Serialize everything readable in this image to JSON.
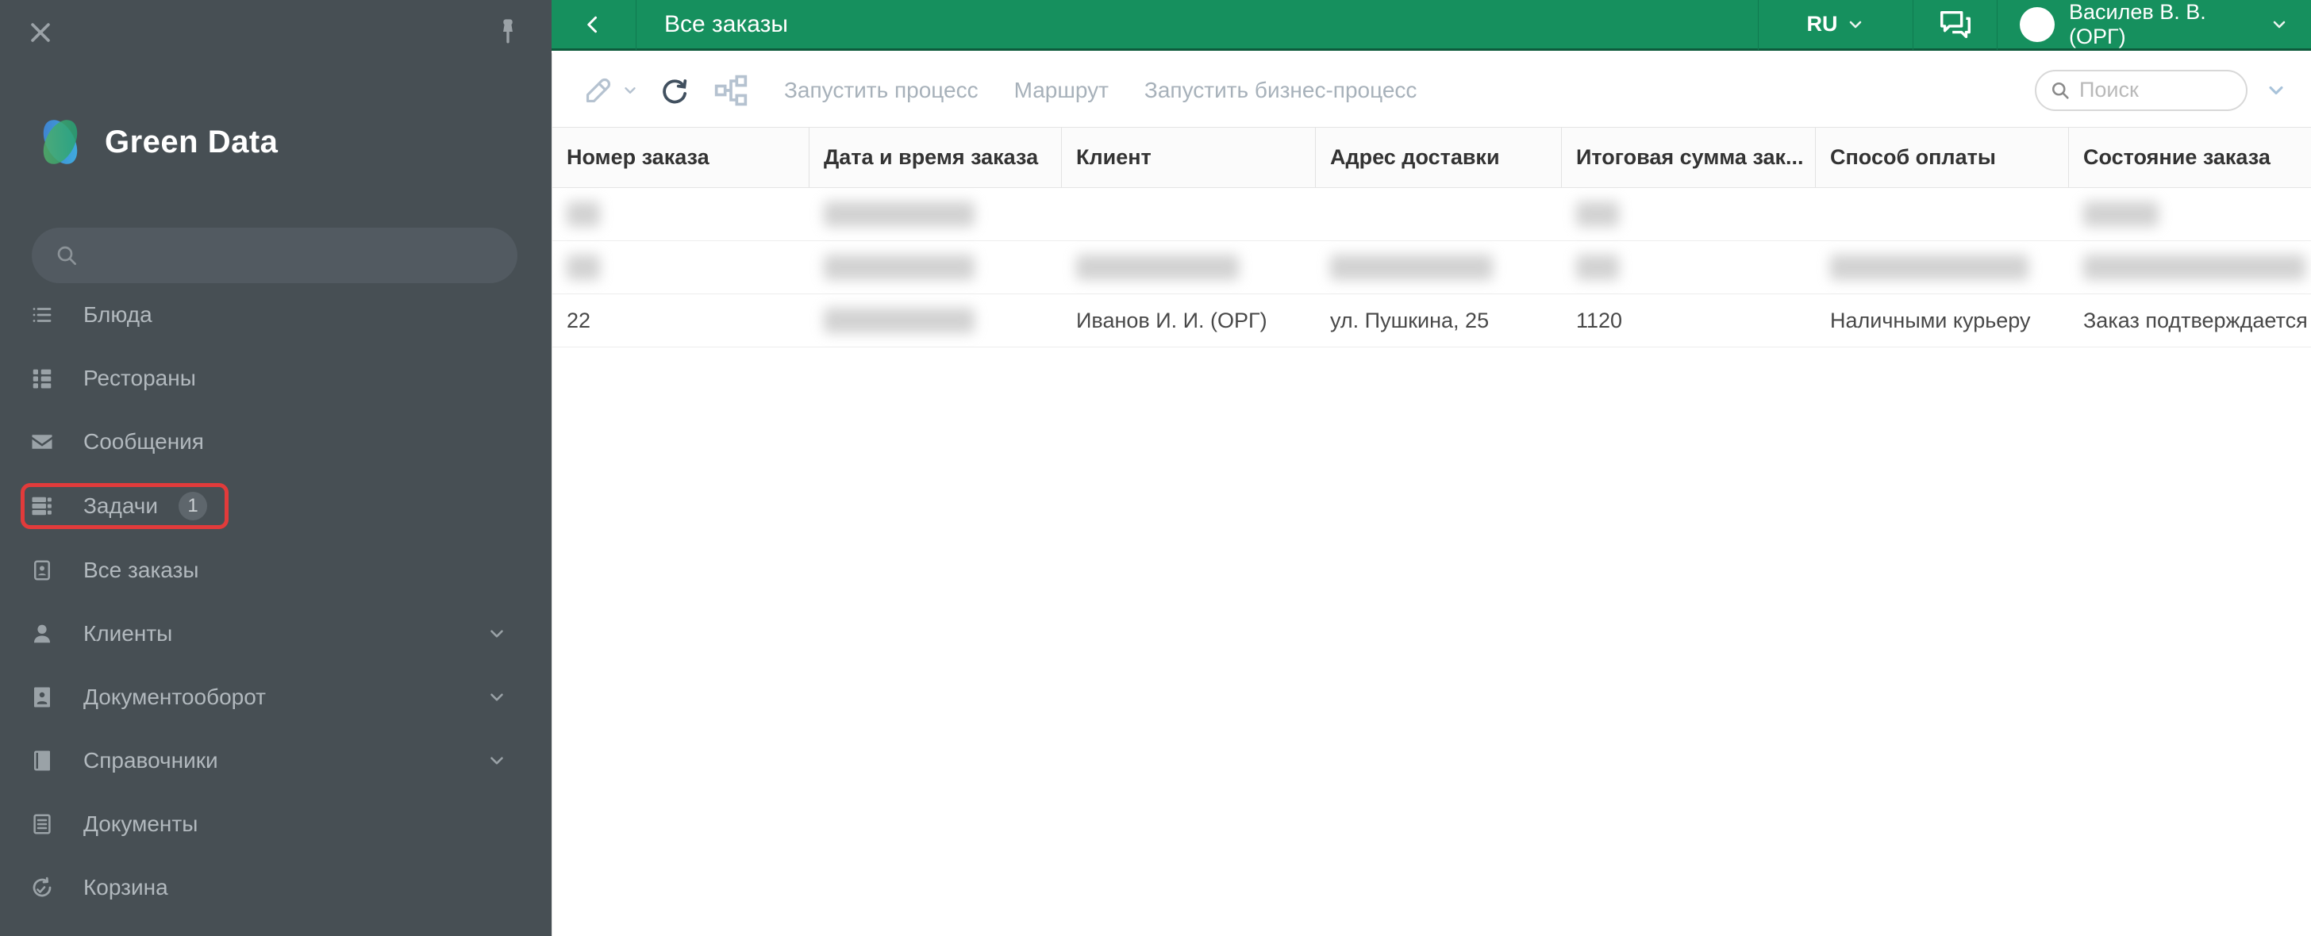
{
  "sidebar": {
    "brand": "Green Data",
    "search_placeholder": "",
    "items": [
      {
        "label": "Блюда"
      },
      {
        "label": "Рестораны"
      },
      {
        "label": "Сообщения"
      },
      {
        "label": "Задачи",
        "badge": "1",
        "highlighted": true
      },
      {
        "label": "Все заказы"
      },
      {
        "label": "Клиенты",
        "expandable": true
      },
      {
        "label": "Документооборот",
        "expandable": true
      },
      {
        "label": "Справочники",
        "expandable": true
      },
      {
        "label": "Документы"
      },
      {
        "label": "Корзина"
      }
    ]
  },
  "topbar": {
    "title": "Все заказы",
    "language": "RU",
    "user": "Василев В. В. (ОРГ)"
  },
  "toolbar": {
    "run_process": "Запустить процесс",
    "route": "Маршрут",
    "run_business_process": "Запустить бизнес-процесс",
    "search_placeholder": "Поиск"
  },
  "table": {
    "columns": [
      "Номер заказа",
      "Дата и время заказа",
      "Клиент",
      "Адрес доставки",
      "Итоговая сумма зак...",
      "Способ оплаты",
      "Состояние заказа"
    ],
    "rows": [
      {
        "num": "",
        "date": "",
        "client": "",
        "address": "",
        "total": "",
        "payment": "",
        "status": "",
        "redacted_columns": [
          "num",
          "date",
          "total",
          "status"
        ]
      },
      {
        "num": "",
        "date": "",
        "client": "",
        "address": "",
        "total": "",
        "payment": "",
        "status": "",
        "redacted_columns": [
          "num",
          "date",
          "client",
          "address",
          "total",
          "payment",
          "status"
        ]
      },
      {
        "num": "22",
        "date": "",
        "client": "Иванов И. И. (ОРГ)",
        "address": "ул. Пушкина, 25",
        "total": "1120",
        "payment": "Наличными курьеру",
        "status": "Заказ подтверждается",
        "redacted_columns": [
          "date"
        ]
      }
    ]
  },
  "colors": {
    "topbar_green": "#16905e",
    "sidebar_dark": "#474f54",
    "highlight_red": "#e23b3b",
    "row_border": "#ededed"
  }
}
